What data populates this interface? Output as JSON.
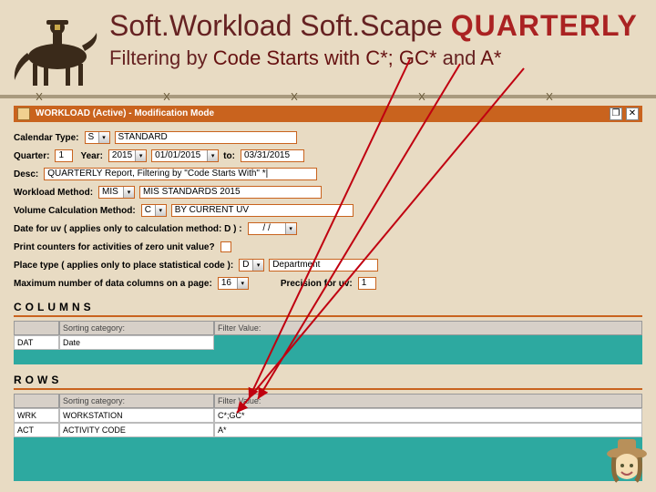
{
  "header": {
    "t1a": "Soft.Workload Soft.Scape ",
    "t1b": "QUARTERLY",
    "t2a": "Filtering by ",
    "t2b": "Code Starts with C*; GC* ",
    "t2c": "and ",
    "t2d": "A*"
  },
  "window": {
    "title": "WORKLOAD (Active) - Modification Mode",
    "restore": "❐",
    "close": "✕"
  },
  "form": {
    "calType": {
      "lbl": "Calendar Type:",
      "v": "S",
      "txt": "STANDARD"
    },
    "quarter": {
      "lbl": "Quarter:",
      "v": "1",
      "yrlbl": "Year:",
      "yr": "2015",
      "from": "01/01/2015",
      "to": "to:",
      "to_v": "03/31/2015"
    },
    "desc": {
      "lbl": "Desc:",
      "v": "QUARTERLY Report, Filtering by \"Code Starts With\" *|"
    },
    "wlm": {
      "lbl": "Workload Method:",
      "v": "MIS",
      "txt": "MIS STANDARDS 2015"
    },
    "vcm": {
      "lbl": "Volume Calculation Method:",
      "v": "C",
      "txt": "BY CURRENT UV"
    },
    "duv": {
      "lbl": "Date for uv ( applies only to calculation method: D ) :",
      "v": "/ /"
    },
    "pc": {
      "lbl": "Print counters for activities of zero unit value?"
    },
    "pt": {
      "lbl": "Place type ( applies only to place statistical code ):",
      "v": "D",
      "txt": "Department"
    },
    "mdc": {
      "lbl": "Maximum number of data columns on a page:",
      "v": "16",
      "prlbl": "Precision for uv:",
      "prv": "1"
    }
  },
  "cols": {
    "title": "COLUMNS",
    "h0": "",
    "h1": "Sorting category:",
    "h2": "Filter Value:",
    "r1c0": "DAT",
    "r1c1": "Date"
  },
  "rows": {
    "title": "ROWS",
    "h0": "",
    "h1": "Sorting category:",
    "h2": "Filter Value:",
    "r1c0": "WRK",
    "r1c1": "WORKSTATION",
    "r1c2": "C*;GC*",
    "r2c0": "ACT",
    "r2c1": "ACTIVITY CODE",
    "r2c2": "A*"
  }
}
